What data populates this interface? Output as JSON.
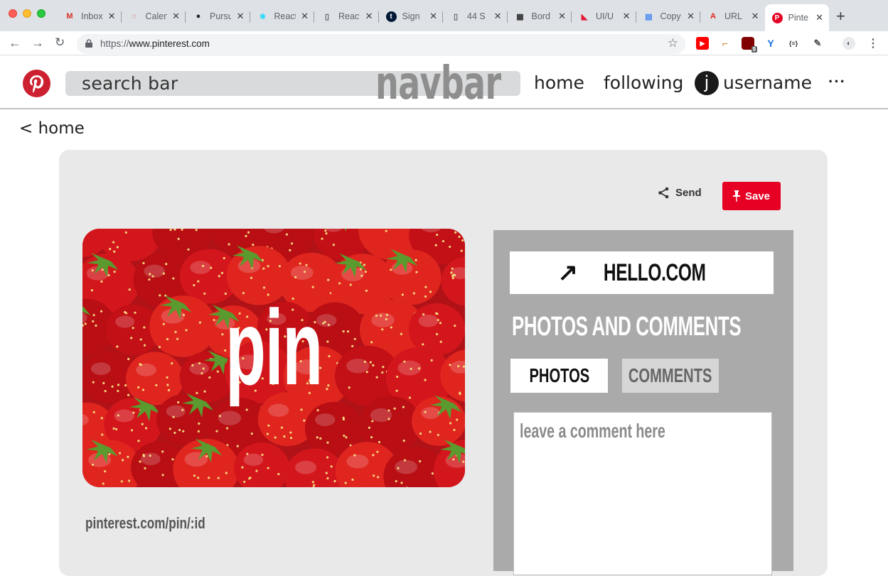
{
  "browser": {
    "tabs": [
      {
        "title": "Inbox",
        "icon": "gmail-icon",
        "color": "#d93025"
      },
      {
        "title": "Calendar",
        "icon": "calendar-icon",
        "color": "#d93025"
      },
      {
        "title": "Pursuit",
        "icon": "github-icon",
        "color": "#24292e"
      },
      {
        "title": "React",
        "icon": "react-icon",
        "color": "#00d8ff"
      },
      {
        "title": "React",
        "icon": "document-icon",
        "color": "#5f6368"
      },
      {
        "title": "Sign",
        "icon": "tumblr-icon",
        "color": "#001935"
      },
      {
        "title": "44 S",
        "icon": "document-icon",
        "color": "#5f6368"
      },
      {
        "title": "Bord",
        "icon": "board-icon",
        "color": "#333333"
      },
      {
        "title": "UI/U",
        "icon": "flag-icon",
        "color": "#e31837"
      },
      {
        "title": "Copy",
        "icon": "docs-icon",
        "color": "#4285f4"
      },
      {
        "title": "URL",
        "icon": "adobe-icon",
        "color": "#e1251b"
      },
      {
        "title": "Pinte",
        "icon": "pinterest-icon",
        "color": "#e60023",
        "active": true
      }
    ],
    "close_glyph": "✕",
    "new_tab_glyph": "+",
    "url_scheme": "https://",
    "url_host": "www.pinterest.com",
    "extension_badge": "9"
  },
  "header": {
    "search_placeholder": "search bar",
    "navbar_label": "navbar",
    "nav_home": "home",
    "nav_following": "following",
    "avatar_letter": "j",
    "username": "username",
    "more": "···"
  },
  "page": {
    "back_link": "< home"
  },
  "pin": {
    "send_label": "Send",
    "save_label": "Save",
    "image_label": "pin",
    "route": "pinterest.com/pin/:id"
  },
  "side": {
    "link_arrow": "↗",
    "link_text": "HELLO.COM",
    "section_title": "PHOTOS AND COMMENTS",
    "tab_photos": "PHOTOS",
    "tab_comments": "COMMENTS",
    "comment_placeholder": "leave a comment here"
  },
  "colors": {
    "pinterest_red": "#e60023",
    "card_bg": "#e9e9e9",
    "side_panel": "#aaaaaa"
  }
}
